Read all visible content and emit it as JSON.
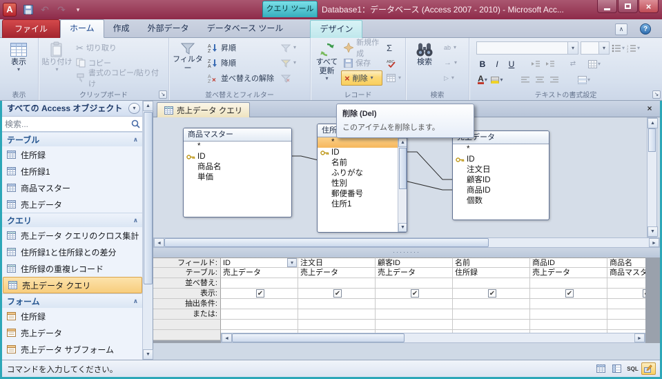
{
  "chrome": {
    "app_letter": "A",
    "help": "?",
    "close": "×"
  },
  "icons": {
    "undo_glyph": "↶",
    "redo_glyph": "↷"
  },
  "win": {
    "title": "Database1：データベース (Access 2007 - 2010) - Microsoft Acc...",
    "tool": "クエリ ツール"
  },
  "tabs": {
    "file": "ファイル",
    "home": "ホーム",
    "create": "作成",
    "external": "外部データ",
    "dbtools": "データベース ツール",
    "design": "デザイン"
  },
  "ribbon": {
    "view": {
      "button": "表示",
      "label": "表示"
    },
    "clipboard": {
      "paste": "貼り付け",
      "cut": "切り取り",
      "copy": "コピー",
      "painter": "書式のコピー/貼り付け",
      "label": "クリップボード"
    },
    "sort": {
      "filter": "フィルター",
      "asc": "昇順",
      "desc": "降順",
      "clear": "並べ替えの解除",
      "label": "並べ替えとフィルター"
    },
    "records": {
      "refresh1": "すべて",
      "refresh2": "更新",
      "new": "新規作成",
      "save": "保存",
      "del": "削除",
      "label": "レコード"
    },
    "find": {
      "find": "検索",
      "label": "検索"
    },
    "textfmt": {
      "b": "B",
      "i": "I",
      "u": "U",
      "label": "テキストの書式設定"
    }
  },
  "tooltip": {
    "title": "削除 (Del)",
    "body": "このアイテムを削除します。"
  },
  "nav": {
    "title": "すべての Access オブジェクト",
    "search_placeholder": "検索...",
    "sections": [
      {
        "label": "テーブル",
        "items": [
          {
            "label": "住所録"
          },
          {
            "label": "住所録1"
          },
          {
            "label": "商品マスター"
          },
          {
            "label": "売上データ"
          }
        ]
      },
      {
        "label": "クエリ",
        "items": [
          {
            "label": "売上データ クエリのクロス集計"
          },
          {
            "label": "住所録1と住所録との差分"
          },
          {
            "label": "住所録の重複レコード"
          },
          {
            "label": "売上データ クエリ"
          }
        ]
      },
      {
        "label": "フォーム",
        "items": [
          {
            "label": "住所録"
          },
          {
            "label": "売上データ"
          },
          {
            "label": "売上データ サブフォーム"
          }
        ]
      }
    ]
  },
  "doc": {
    "tab": "売上データ クエリ",
    "tables": [
      {
        "name": "商品マスター",
        "fields": [
          "*",
          "ID",
          "商品名",
          "単価"
        ]
      },
      {
        "name": "住所録",
        "fields": [
          "*",
          "ID",
          "名前",
          "ふりがな",
          "性別",
          "郵便番号",
          "住所1"
        ]
      },
      {
        "name": "売上データ",
        "fields": [
          "*",
          "ID",
          "注文日",
          "顧客ID",
          "商品ID",
          "個数"
        ]
      }
    ],
    "grid": {
      "rows": {
        "field": "フィールド:",
        "table": "テーブル:",
        "sort": "並べ替え:",
        "show": "表示:",
        "criteria": "抽出条件:",
        "or": "または:"
      },
      "cols": [
        {
          "field": "ID",
          "table": "売上データ",
          "checked": true
        },
        {
          "field": "注文日",
          "table": "売上データ",
          "checked": true
        },
        {
          "field": "顧客ID",
          "table": "売上データ",
          "checked": true
        },
        {
          "field": "名前",
          "table": "住所録",
          "checked": true
        },
        {
          "field": "商品ID",
          "table": "売上データ",
          "checked": true
        },
        {
          "field": "商品名",
          "table": "商品マスター",
          "checked": true
        }
      ]
    }
  },
  "status": {
    "message": "コマンドを入力してください。",
    "sql": "SQL"
  }
}
